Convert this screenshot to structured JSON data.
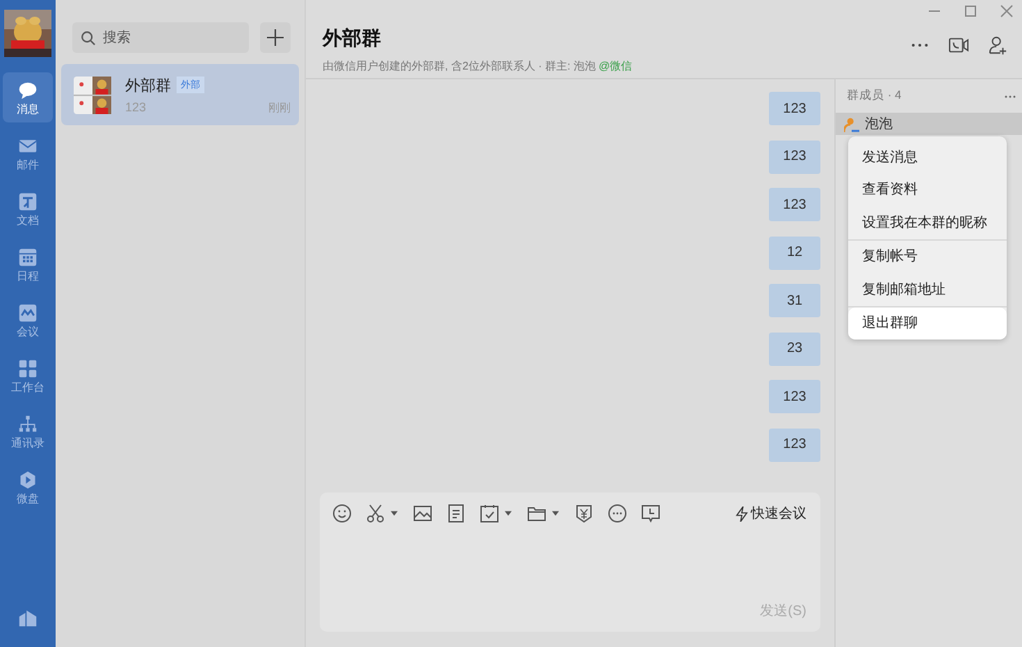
{
  "nav": {
    "items": [
      {
        "label": "消息",
        "selected": true
      },
      {
        "label": "邮件",
        "selected": false
      },
      {
        "label": "文档",
        "selected": false
      },
      {
        "label": "日程",
        "selected": false
      },
      {
        "label": "会议",
        "selected": false
      },
      {
        "label": "工作台",
        "selected": false
      },
      {
        "label": "通讯录",
        "selected": false
      },
      {
        "label": "微盘",
        "selected": false
      }
    ]
  },
  "search": {
    "placeholder": "搜索"
  },
  "conversations": [
    {
      "name": "外部群",
      "tag": "外部",
      "preview": "123",
      "time": "刚刚",
      "selected": true
    }
  ],
  "chat": {
    "title": "外部群",
    "subtitle": "由微信用户创建的外部群, 含2位外部联系人 · 群主: 泡泡",
    "source": "@微信",
    "messages": [
      "123",
      "123",
      "123",
      "12",
      "31",
      "23",
      "123",
      "123"
    ],
    "quick_meeting": "快速会议",
    "send": "发送(S)"
  },
  "members": {
    "heading": "群成员 · 4",
    "items": [
      {
        "name": "泡泡",
        "selected": true
      }
    ]
  },
  "context_menu": {
    "groups": [
      [
        {
          "label": "发送消息",
          "highlighted": false
        },
        {
          "label": "查看资料",
          "highlighted": false
        },
        {
          "label": "设置我在本群的昵称",
          "highlighted": false
        }
      ],
      [
        {
          "label": "复制帐号",
          "highlighted": false
        },
        {
          "label": "复制邮箱地址",
          "highlighted": false
        }
      ],
      [
        {
          "label": "退出群聊",
          "highlighted": true
        }
      ]
    ]
  }
}
